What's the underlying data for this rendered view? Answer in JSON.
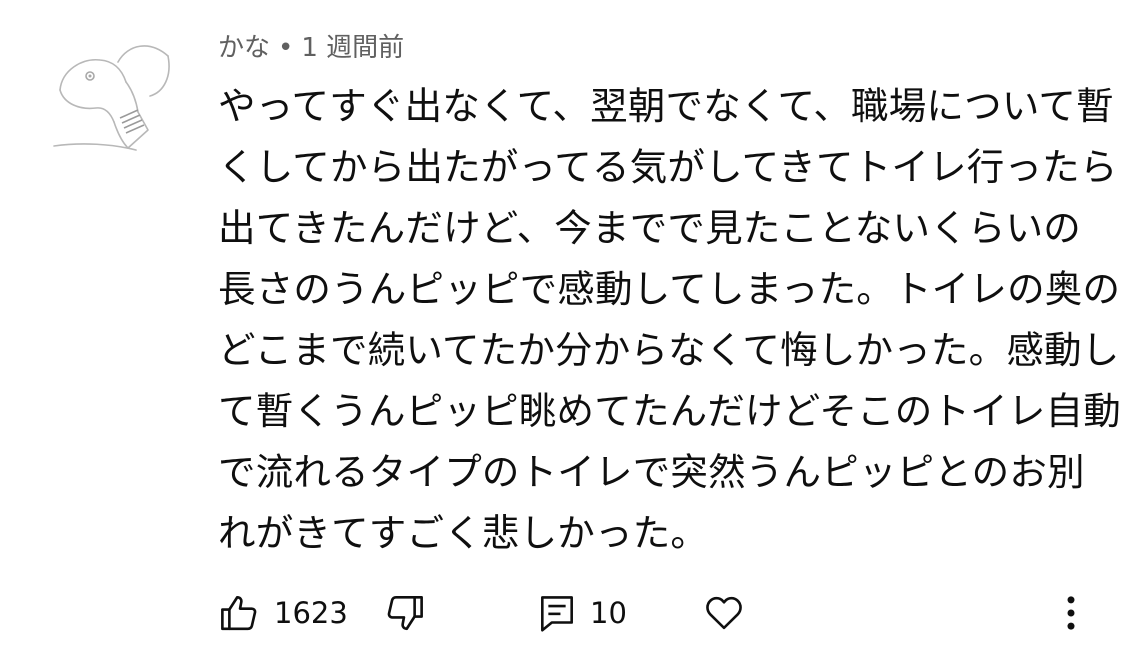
{
  "comment": {
    "author": "かな",
    "separator": "•",
    "time_ago": "1 週間前",
    "lines": [
      "やってすぐ出なくて、翌朝でなくて、職場について暫",
      "くしてから出たがってる気がしてきてトイレ行ったら",
      "出てきたんだけど、今までで見たことないくらいの",
      "長さのうんピッピで感動してしまった。トイレの奥の",
      "どこまで続いてたか分からなくて悔しかった。感動し",
      "て暫くうんピッピ眺めてたんだけどそこのトイレ自動",
      "で流れるタイプのトイレで突然うんピッピとのお別",
      "れがきてすごく悲しかった。"
    ]
  },
  "actions": {
    "like_count": "1623",
    "reply_count": "10",
    "icons": {
      "like": "thumbs-up-icon",
      "dislike": "thumbs-down-icon",
      "reply": "reply-icon",
      "heart": "heart-icon",
      "more": "more-vertical-icon"
    }
  },
  "colors": {
    "text": "#0f0f0f",
    "meta": "#606060",
    "background": "#ffffff"
  }
}
